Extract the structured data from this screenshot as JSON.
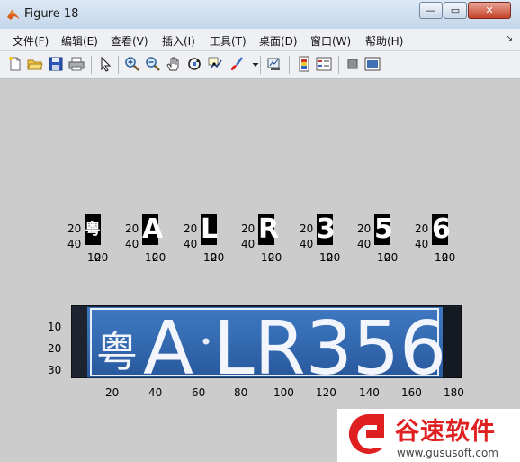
{
  "window": {
    "title": "Figure 18",
    "btn_min": "—",
    "btn_max": "▭",
    "btn_close": "✕"
  },
  "menu": [
    {
      "label": "文件(F)"
    },
    {
      "label": "编辑(E)"
    },
    {
      "label": "查看(V)"
    },
    {
      "label": "插入(I)"
    },
    {
      "label": "工具(T)"
    },
    {
      "label": "桌面(D)"
    },
    {
      "label": "窗口(W)"
    },
    {
      "label": "帮助(H)"
    }
  ],
  "menu_overflow": "↘",
  "toolbar": {
    "icons": [
      "new-figure-icon",
      "open-file-icon",
      "save-icon",
      "print-icon",
      "edit-plot-arrow-icon",
      "zoom-in-icon",
      "zoom-out-icon",
      "pan-hand-icon",
      "rotate-3d-icon",
      "data-cursor-icon",
      "brush-icon",
      "brush-dropdown-icon",
      "link-plot-icon",
      "colorbar-icon",
      "legend-icon",
      "hide-plot-tools-icon",
      "show-plot-tools-icon"
    ]
  },
  "chars": [
    {
      "char": "粤"
    },
    {
      "char": "A"
    },
    {
      "char": "L"
    },
    {
      "char": "R"
    },
    {
      "char": "3"
    },
    {
      "char": "5"
    },
    {
      "char": "6"
    }
  ],
  "subplot_ticks": {
    "y": [
      "20",
      "40"
    ],
    "x": [
      "10",
      "20"
    ]
  },
  "plate_image": {
    "text": "粤A LR356",
    "y_ticks": [
      "10",
      "20",
      "30"
    ],
    "x_ticks": [
      "20",
      "40",
      "60",
      "80",
      "100",
      "120",
      "140",
      "160",
      "180"
    ]
  },
  "watermark": {
    "brand": "谷速软件",
    "url": "www.gususoft.com",
    "accent": "#e02020"
  }
}
